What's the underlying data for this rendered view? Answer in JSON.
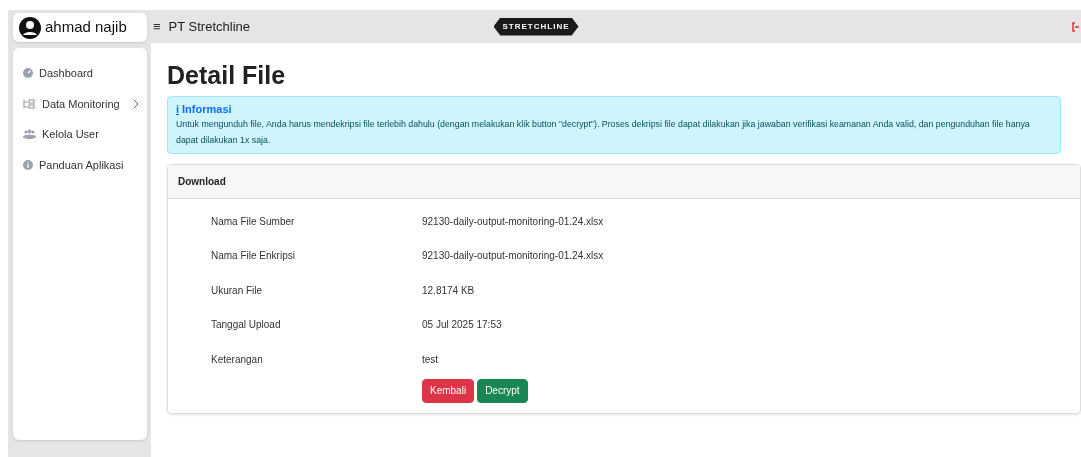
{
  "user": {
    "name": "ahmad najib"
  },
  "header": {
    "menu_glyph": "≡",
    "title": "PT Stretchline",
    "logo_text": "STRETCHLINE"
  },
  "sidebar": {
    "items": [
      {
        "kind": "dashboard",
        "label": "Dashboard",
        "has_submenu": false
      },
      {
        "kind": "monitoring",
        "label": "Data Monitoring",
        "has_submenu": true
      },
      {
        "kind": "users",
        "label": "Kelola User",
        "has_submenu": false
      },
      {
        "kind": "info",
        "label": "Panduan Aplikasi",
        "has_submenu": false
      }
    ]
  },
  "page": {
    "title": "Detail File"
  },
  "alert": {
    "icon_glyph": "i",
    "title": "Informasi",
    "text": "Untuk mengunduh file, Anda harus mendekripsi file terlebih dahulu (dengan melakukan klik button \"decrypt\"). Proses dekripsi file dapat dilakukan jika jawaban verifikasi keamanan Anda valid, dan pengunduhan file hanya dapat dilakukan 1x saja."
  },
  "card": {
    "title": "Download",
    "rows": [
      {
        "label": "Nama File Sumber",
        "value": "92130-daily-output-monitoring-01.24.xlsx"
      },
      {
        "label": "Nama File Enkripsi",
        "value": "92130-daily-output-monitoring-01.24.xlsx"
      },
      {
        "label": "Ukuran File",
        "value": "12.8174 KB"
      },
      {
        "label": "Tanggal Upload",
        "value": "05 Jul 2025 17:53"
      },
      {
        "label": "Keterangan",
        "value": "test"
      }
    ],
    "buttons": [
      {
        "kind": "danger",
        "label": "Kembali"
      },
      {
        "kind": "success",
        "label": "Decrypt"
      }
    ]
  }
}
